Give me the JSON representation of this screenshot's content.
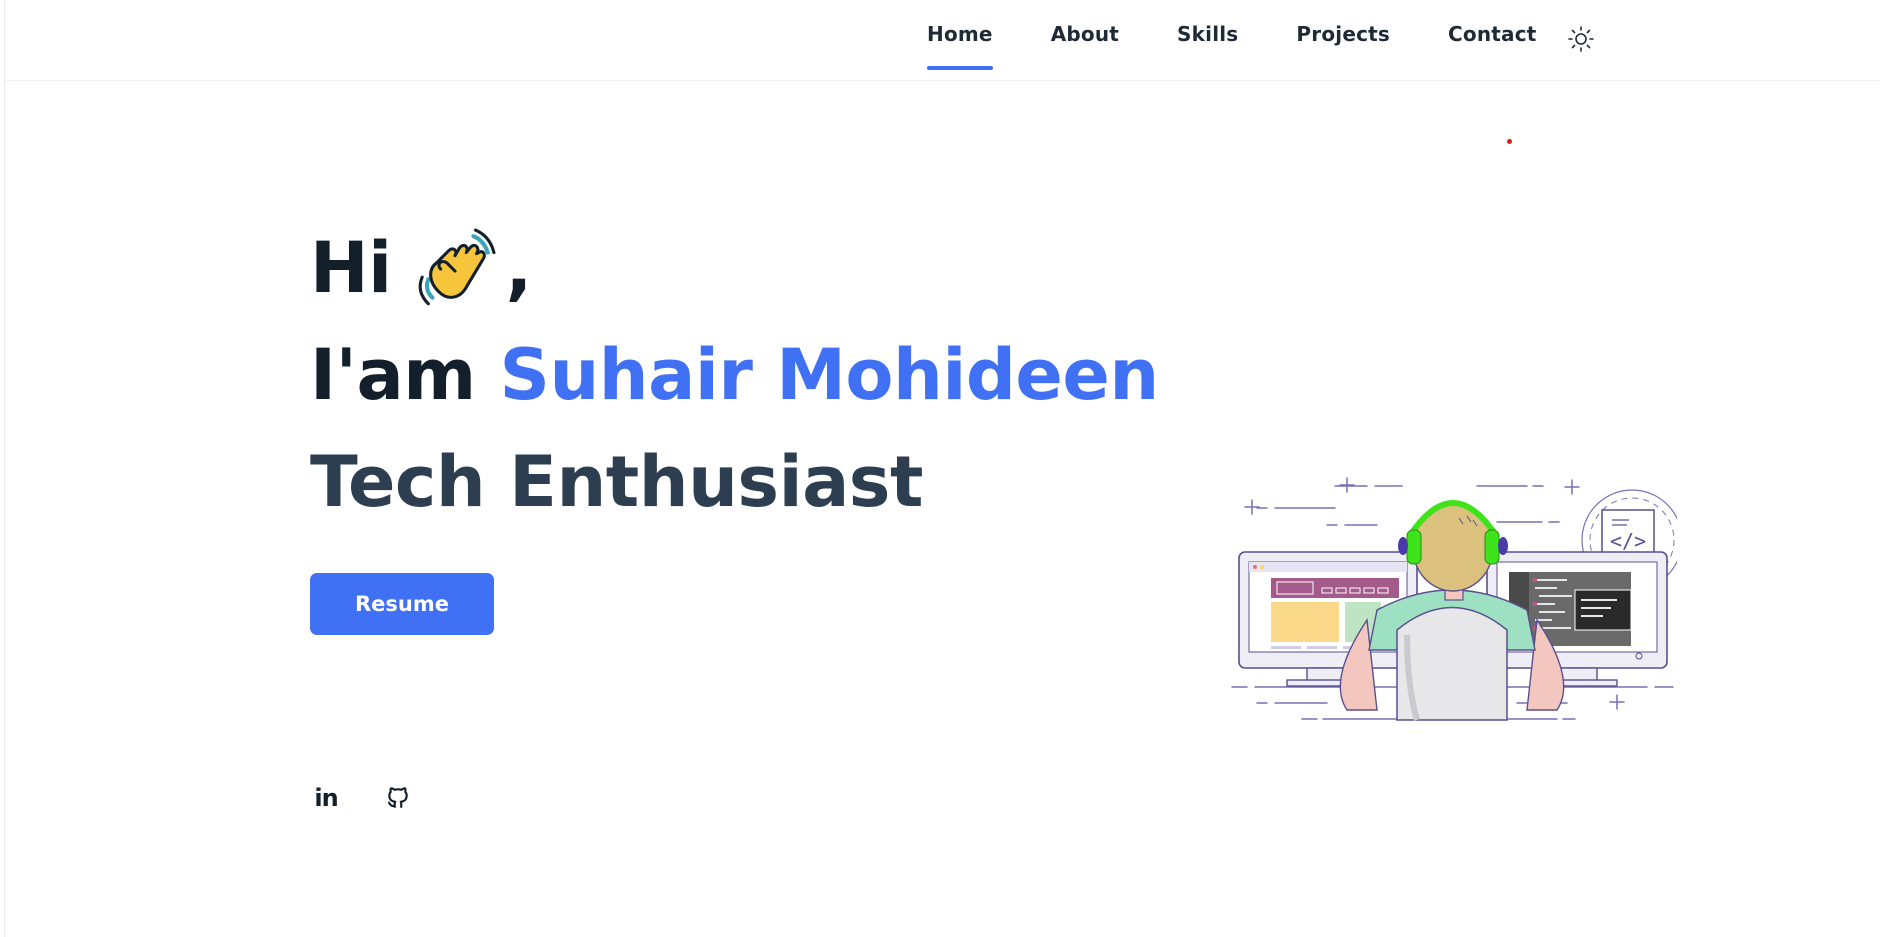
{
  "nav": {
    "items": [
      {
        "label": "Home",
        "active": true
      },
      {
        "label": "About",
        "active": false
      },
      {
        "label": "Skills",
        "active": false
      },
      {
        "label": "Projects",
        "active": false
      },
      {
        "label": "Contact",
        "active": false
      }
    ],
    "theme_toggle_icon": "sun-icon"
  },
  "hero": {
    "greeting": "Hi",
    "greeting_emoji": "waving-hand-icon",
    "greeting_suffix": ",",
    "intro": "I'am ",
    "name": "Suhair Mohideen",
    "role": "Tech Enthusiast"
  },
  "resume_button": {
    "label": "Resume"
  },
  "socials": [
    {
      "icon": "linkedin-icon",
      "text": "in"
    },
    {
      "icon": "github-icon"
    }
  ],
  "colors": {
    "accent": "#4070f4",
    "text_dark": "#13202c",
    "text_role": "#2c3e50",
    "indicator_dot": "#e01c1c"
  }
}
